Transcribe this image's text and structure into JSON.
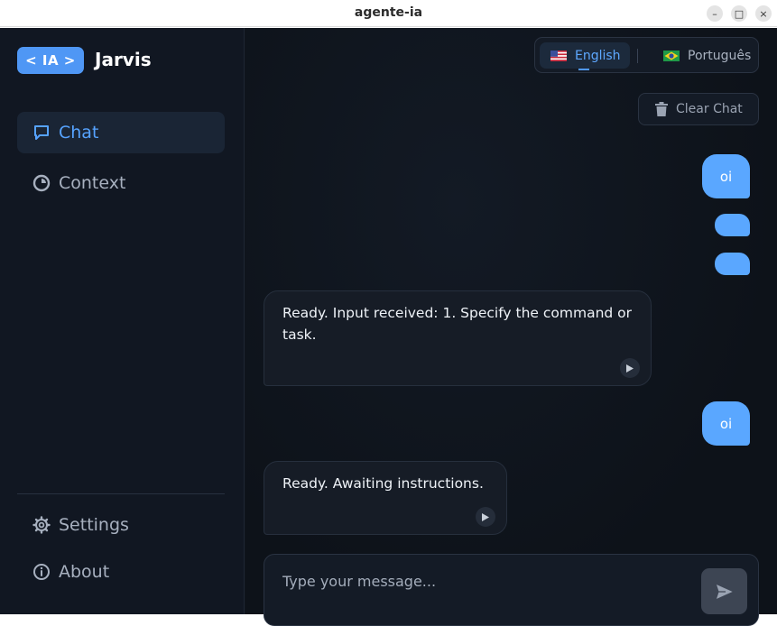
{
  "window": {
    "title": "agente-ia",
    "minimize_glyph": "–",
    "maximize_glyph": "□",
    "close_glyph": "×"
  },
  "sidebar": {
    "logo_badge": "< IA >",
    "brand_name": "Jarvis",
    "nav": [
      {
        "label": "Chat",
        "icon": "chat-bubble-icon",
        "active": true
      },
      {
        "label": "Context",
        "icon": "pie-chart-icon",
        "active": false
      }
    ],
    "footer": [
      {
        "label": "Settings",
        "icon": "gear-icon"
      },
      {
        "label": "About",
        "icon": "info-icon"
      }
    ]
  },
  "header": {
    "languages": [
      {
        "label": "English",
        "flag": "us-flag-icon",
        "active": true
      },
      {
        "label": "Português",
        "flag": "brazil-flag-icon",
        "active": false
      }
    ],
    "clear_chat_label": "Clear Chat"
  },
  "messages": [
    {
      "role": "user",
      "text": "oi"
    },
    {
      "role": "user",
      "text": ""
    },
    {
      "role": "user",
      "text": ""
    },
    {
      "role": "assistant",
      "text": "Ready. Input received: 1. Specify the command or task."
    },
    {
      "role": "user",
      "text": "oi"
    },
    {
      "role": "assistant",
      "text": "Ready. Awaiting instructions."
    }
  ],
  "composer": {
    "placeholder": "Type your message...",
    "value": ""
  },
  "colors": {
    "accent": "#4f97f5",
    "user_bubble": "#5aa7ff",
    "background": "#0f141c"
  }
}
